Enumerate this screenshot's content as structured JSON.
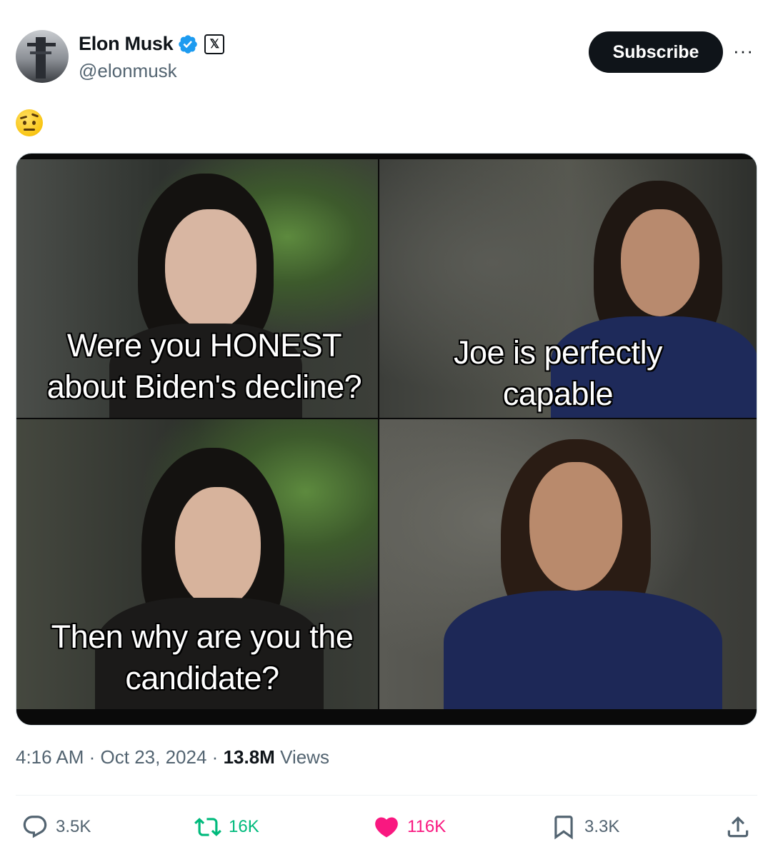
{
  "author": {
    "name": "Elon Musk",
    "handle": "@elonmusk",
    "x_badge": "𝕏"
  },
  "header": {
    "subscribe_label": "Subscribe",
    "more_label": "···"
  },
  "post": {
    "emoji_icon": "face-with-raised-eyebrow-icon",
    "captions": {
      "top_left": "Were you HONEST about Biden's decline?",
      "top_right": "Joe is perfectly capable",
      "bottom_left": "Then why are you the candidate?"
    }
  },
  "meta": {
    "time": "4:16 AM",
    "separator": "·",
    "date": "Oct 23, 2024",
    "views_count": "13.8M",
    "views_label": "Views"
  },
  "actions": {
    "replies": "3.5K",
    "reposts": "16K",
    "likes": "116K",
    "bookmarks": "3.3K"
  },
  "colors": {
    "verified_blue": "#1d9bf0",
    "repost_green": "#00ba7c",
    "like_pink": "#f91880",
    "secondary_text": "#536471"
  }
}
